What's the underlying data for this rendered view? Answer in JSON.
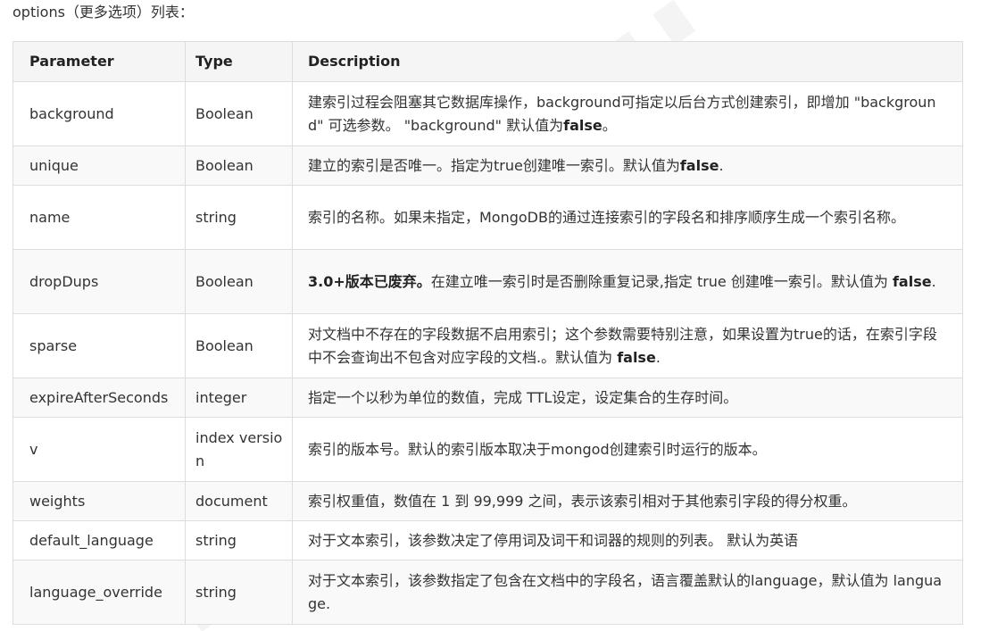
{
  "intro": "options（更多选项）列表：",
  "table": {
    "headers": [
      "Parameter",
      "Type",
      "Description"
    ],
    "rows": [
      {
        "param": "background",
        "type": "Boolean",
        "desc": [
          {
            "t": "建索引过程会阻塞其它数据库操作，background可指定以后台方式创建索引，即增加 \"background\" 可选参数。 \"background\" 默认值为"
          },
          {
            "t": "false",
            "b": true
          },
          {
            "t": "。"
          }
        ]
      },
      {
        "param": "unique",
        "type": "Boolean",
        "desc": [
          {
            "t": "建立的索引是否唯一。指定为true创建唯一索引。默认值为"
          },
          {
            "t": "false",
            "b": true
          },
          {
            "t": "."
          }
        ]
      },
      {
        "param": "name",
        "type": "string",
        "desc": [
          {
            "t": "索引的名称。如果未指定，MongoDB的通过连接索引的字段名和排序顺序生成一个索引名称。"
          }
        ]
      },
      {
        "param": "dropDups",
        "type": "Boolean",
        "desc": [
          {
            "t": "3.0+版本已废弃。",
            "b": true
          },
          {
            "t": "在建立唯一索引时是否删除重复记录,指定 true 创建唯一索引。默认值为 "
          },
          {
            "t": "false",
            "b": true
          },
          {
            "t": "."
          }
        ]
      },
      {
        "param": "sparse",
        "type": "Boolean",
        "desc": [
          {
            "t": "对文档中不存在的字段数据不启用索引；这个参数需要特别注意，如果设置为true的话，在索引字段中不会查询出不包含对应字段的文档.。默认值为 "
          },
          {
            "t": "false",
            "b": true
          },
          {
            "t": "."
          }
        ]
      },
      {
        "param": "expireAfterSeconds",
        "type": "integer",
        "desc": [
          {
            "t": "指定一个以秒为单位的数值，完成 TTL设定，设定集合的生存时间。"
          }
        ]
      },
      {
        "param": "v",
        "type": "index version",
        "desc": [
          {
            "t": "索引的版本号。默认的索引版本取决于mongod创建索引时运行的版本。"
          }
        ]
      },
      {
        "param": "weights",
        "type": "document",
        "desc": [
          {
            "t": "索引权重值，数值在 1 到 99,999 之间，表示该索引相对于其他索引字段的得分权重。"
          }
        ]
      },
      {
        "param": "default_language",
        "type": "string",
        "desc": [
          {
            "t": "对于文本索引，该参数决定了停用词及词干和词器的规则的列表。 默认为英语"
          }
        ]
      },
      {
        "param": "language_override",
        "type": "string",
        "desc": [
          {
            "t": "对于文本索引，该参数指定了包含在文档中的字段名，语言覆盖默认的language，默认值为 language."
          }
        ]
      }
    ]
  }
}
